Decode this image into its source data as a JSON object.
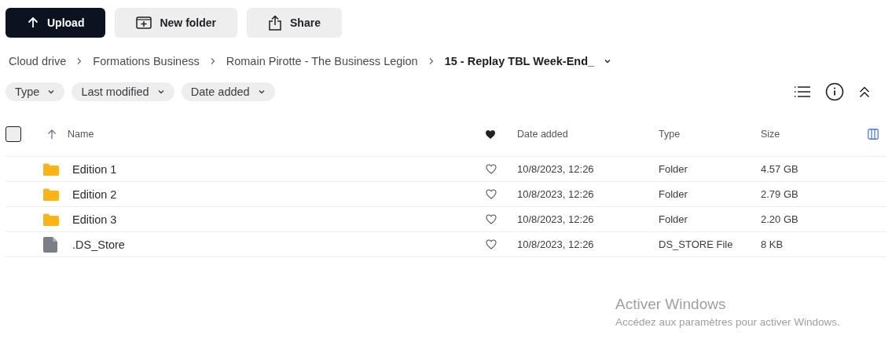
{
  "toolbar": {
    "buttons": [
      {
        "label": "Upload",
        "kind": "primary"
      },
      {
        "label": "New folder",
        "kind": "new-folder"
      },
      {
        "label": "Share",
        "kind": "share"
      }
    ]
  },
  "breadcrumb": {
    "items": [
      "Cloud drive",
      "Formations Business",
      "Romain Pirotte - The Business Legion"
    ],
    "current": "15 - Replay TBL Week-End_"
  },
  "filters": [
    "Type",
    "Last modified",
    "Date added"
  ],
  "table": {
    "select_all": {
      "checked": false
    },
    "columns": [
      "Name",
      "Date added",
      "Type",
      "Size"
    ],
    "rows": [
      {
        "kind": "folder",
        "name": "Edition 1",
        "favorite": false,
        "date_added": "10/8/2023, 12:26",
        "type": "Folder",
        "size": "4.57 GB"
      },
      {
        "kind": "folder",
        "name": "Edition 2",
        "favorite": false,
        "date_added": "10/8/2023, 12:26",
        "type": "Folder",
        "size": "2.79 GB"
      },
      {
        "kind": "folder",
        "name": "Edition 3",
        "favorite": false,
        "date_added": "10/8/2023, 12:26",
        "type": "Folder",
        "size": "2.20 GB"
      },
      {
        "kind": "file",
        "name": ".DS_Store",
        "favorite": false,
        "date_added": "10/8/2023, 12:26",
        "type": "DS_STORE File",
        "size": "8 KB"
      }
    ]
  },
  "windows_activation": {
    "title": "Activer Windows",
    "message": "Accédez aux paramètres pour activer Windows."
  }
}
